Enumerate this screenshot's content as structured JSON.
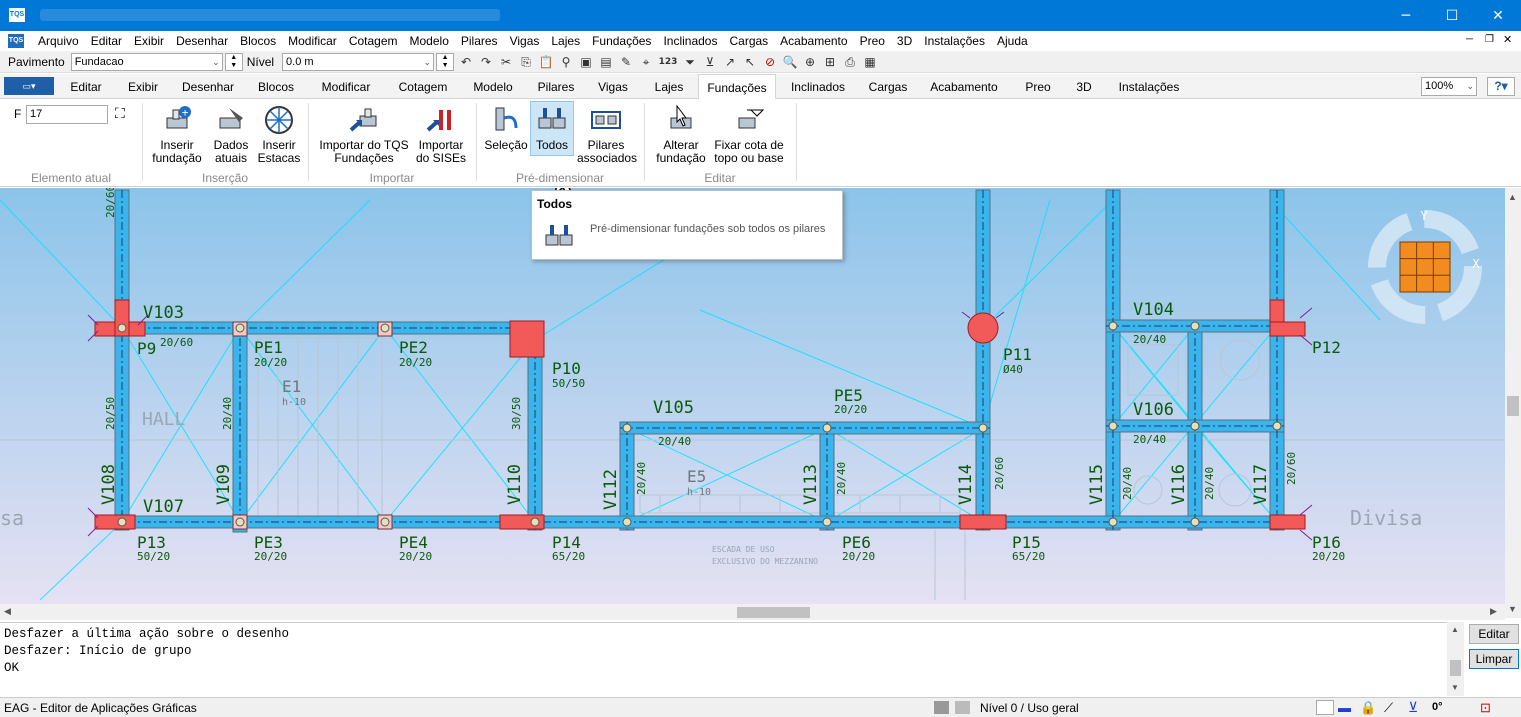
{
  "app": {
    "logo": "TQS",
    "window_controls": {
      "minimize": "─",
      "maximize": "☐",
      "close": "✕"
    }
  },
  "menu": [
    "Arquivo",
    "Editar",
    "Exibir",
    "Desenhar",
    "Blocos",
    "Modificar",
    "Cotagem",
    "Modelo",
    "Pilares",
    "Vigas",
    "Lajes",
    "Fundações",
    "Inclinados",
    "Cargas",
    "Acabamento",
    "Preo",
    "3D",
    "Instalações",
    "Ajuda"
  ],
  "toolbar": {
    "pavimento_label": "Pavimento",
    "pavimento_value": "Fundacao",
    "nivel_label": "Nível",
    "nivel_value": "0.0 m",
    "counter": "123"
  },
  "tabs": [
    "Editar",
    "Exibir",
    "Desenhar",
    "Blocos",
    "Modificar",
    "Cotagem",
    "Modelo",
    "Pilares",
    "Vigas",
    "Lajes",
    "Fundações",
    "Inclinados",
    "Cargas",
    "Acabamento",
    "Preo",
    "3D",
    "Instalações"
  ],
  "active_tab": "Fundações",
  "zoom": "100%",
  "help": "?",
  "ribbon": {
    "field_label": "F",
    "field_value": "17",
    "buttons": {
      "inserir": "Inserir fundação",
      "dados": "Dados atuais",
      "estacas": "Inserir Estacas",
      "imp_tqs": "Importar do TQS Fundações",
      "imp_sises": "Importar do SISEs",
      "selecao": "Seleção",
      "todos": "Todos",
      "pilares": "Pilares associados",
      "alterar": "Alterar fundação",
      "fixar": "Fixar cota de topo ou base"
    },
    "groups": {
      "elemento": "Elemento atual",
      "insercao": "Inserção",
      "importar": "Importar",
      "predim": "Pré-dimensionar",
      "editar": "Editar"
    }
  },
  "tooltip": {
    "title": "Todos",
    "text": "Pré-dimensionar fundações sob todos os pilares"
  },
  "compass": {
    "y": "Y",
    "x": "X"
  },
  "drawing": {
    "pillars": [
      {
        "n": "P9",
        "d": "20/60"
      },
      {
        "n": "P10",
        "d": "50/50"
      },
      {
        "n": "P11",
        "d": "Ø40"
      },
      {
        "n": "P12",
        "d": ""
      },
      {
        "n": "P13",
        "d": "50/20"
      },
      {
        "n": "P14",
        "d": "65/20"
      },
      {
        "n": "P15",
        "d": "65/20"
      },
      {
        "n": "P16",
        "d": "20/20"
      },
      {
        "n": "PE1",
        "d": "20/20"
      },
      {
        "n": "PE2",
        "d": "20/20"
      },
      {
        "n": "PE3",
        "d": "20/20"
      },
      {
        "n": "PE4",
        "d": "20/20"
      },
      {
        "n": "PE5",
        "d": "20/20"
      },
      {
        "n": "PE6",
        "d": "20/20"
      }
    ],
    "beams": [
      "V103",
      "V104",
      "V105",
      "V106",
      "V107",
      "V108",
      "V109",
      "V110",
      "V112",
      "V113",
      "V114",
      "V115",
      "V116",
      "V117"
    ],
    "beam_dims": [
      "20/60",
      "20/40",
      "20/50",
      "30/50",
      "20/40",
      "20/40",
      "20/40",
      "20/60",
      "20/40",
      "20/40",
      "20/60",
      "20/40",
      "20/40",
      "20/60"
    ],
    "labels": {
      "hall": "HALL",
      "divisa": "Divisa",
      "divisa_left": "sa",
      "e1": "E1",
      "e1h": "h-10",
      "e5": "E5",
      "e5h": "h-10",
      "escada1": "ESCADA DE USO",
      "escada2": "EXCLUSIVO DO MEZZANINO"
    }
  },
  "command_lines": [
    "Desfazer a última ação sobre o desenho",
    "Desfazer:  Início de grupo",
    "OK"
  ],
  "side_buttons": {
    "editar": "Editar",
    "limpar": "Limpar"
  },
  "status": {
    "app_name": "EAG - Editor de Aplicações Gráficas",
    "level": "Nível 0 / Uso geral",
    "angle": "0°"
  }
}
